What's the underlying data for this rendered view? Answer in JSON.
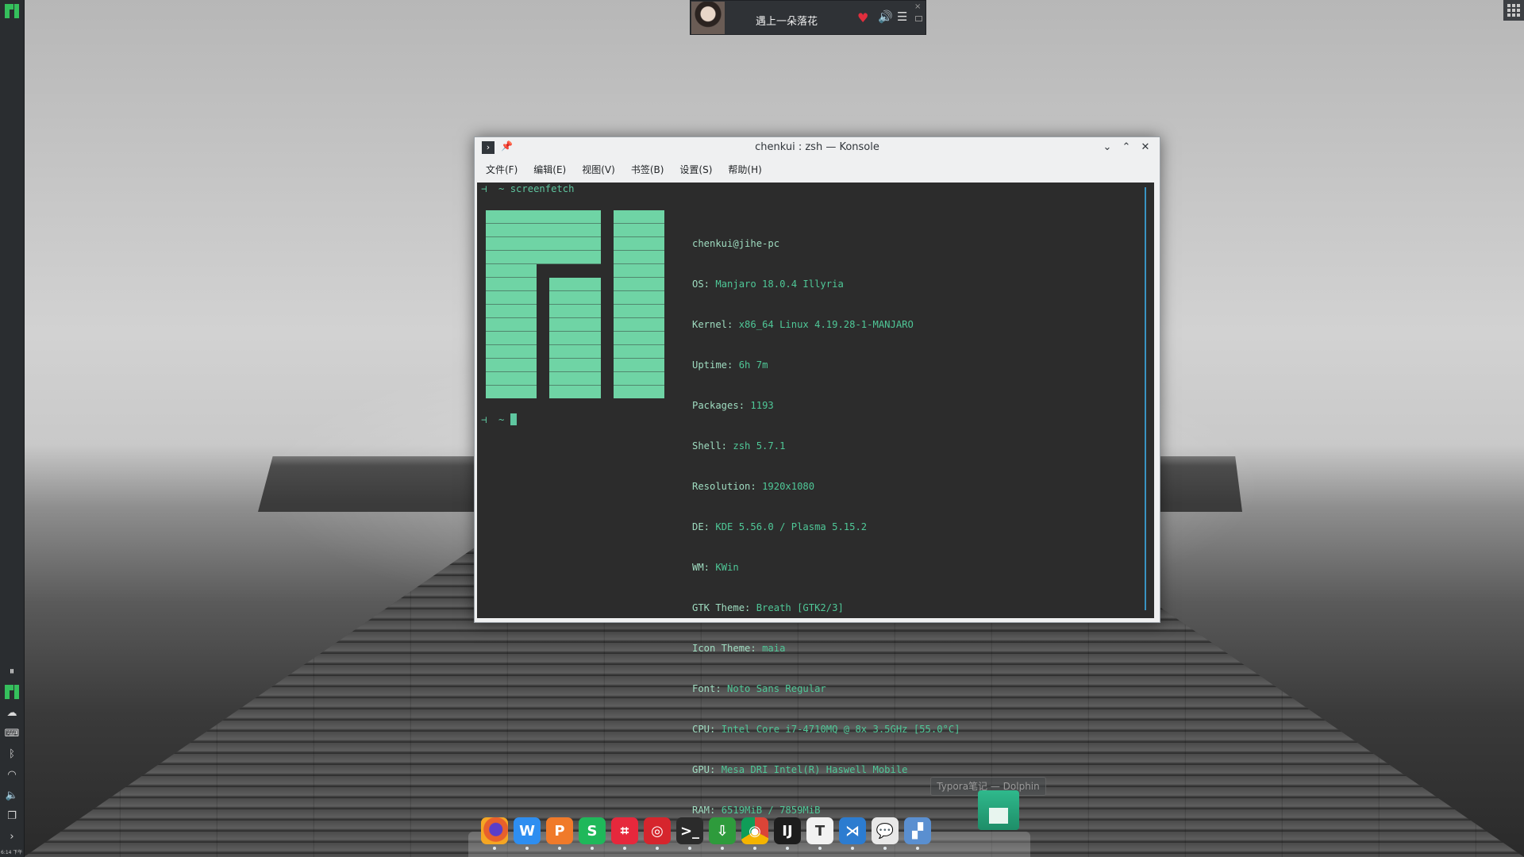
{
  "music": {
    "song_title": "遇上一朵落花",
    "heart_glyph": "♥",
    "volume_glyph": "🔊",
    "playlist_glyph": "☰",
    "close_glyph": "×"
  },
  "window": {
    "title": "chenkui : zsh — Konsole",
    "menus": [
      "文件(F)",
      "编辑(E)",
      "视图(V)",
      "书签(B)",
      "设置(S)",
      "帮助(H)"
    ]
  },
  "terminal": {
    "prompt_symbol": "⊣",
    "command": "screenfetch",
    "user_host": "chenkui@jihe-pc",
    "info": [
      {
        "key": "OS:",
        "value": "Manjaro 18.0.4 Illyria"
      },
      {
        "key": "Kernel:",
        "value": "x86_64 Linux 4.19.28-1-MANJARO"
      },
      {
        "key": "Uptime:",
        "value": "6h 7m"
      },
      {
        "key": "Packages:",
        "value": "1193"
      },
      {
        "key": "Shell:",
        "value": "zsh 5.7.1"
      },
      {
        "key": "Resolution:",
        "value": "1920x1080"
      },
      {
        "key": "DE:",
        "value": "KDE 5.56.0 / Plasma 5.15.2"
      },
      {
        "key": "WM:",
        "value": "KWin"
      },
      {
        "key": "GTK Theme:",
        "value": "Breath [GTK2/3]"
      },
      {
        "key": "Icon Theme:",
        "value": "maia"
      },
      {
        "key": "Font:",
        "value": "Noto Sans Regular"
      },
      {
        "key": "CPU:",
        "value": "Intel Core i7-4710MQ @ 8x 3.5GHz [55.0°C]"
      },
      {
        "key": "GPU:",
        "value": "Mesa DRI Intel(R) Haswell Mobile"
      },
      {
        "key": "RAM:",
        "value": "6519MiB / 7859MiB"
      }
    ]
  },
  "tooltip": "Typora笔记 — Dolphin",
  "clock": "6:14 下午",
  "dock": [
    {
      "name": "firefox",
      "color": "#e8602c",
      "glyph": ""
    },
    {
      "name": "wps-writer",
      "color": "#2e8ef0",
      "glyph": "W"
    },
    {
      "name": "wps-presentation",
      "color": "#f07a2a",
      "glyph": "P"
    },
    {
      "name": "wps-spreadsheet",
      "color": "#1fb85a",
      "glyph": "S"
    },
    {
      "name": "screenshot-crop",
      "color": "#e6283c",
      "glyph": "⌗"
    },
    {
      "name": "netease-music",
      "color": "#d6252d",
      "glyph": "◎"
    },
    {
      "name": "terminal",
      "color": "#2b2b2b",
      "glyph": ">_"
    },
    {
      "name": "download-manager",
      "color": "#2e9b3c",
      "glyph": "⇩"
    },
    {
      "name": "chrome",
      "color": "#dcbc2a",
      "glyph": "◉"
    },
    {
      "name": "intellij",
      "color": "#1d1d1d",
      "glyph": "IJ"
    },
    {
      "name": "typora",
      "color": "#f2f2f2",
      "glyph": "T"
    },
    {
      "name": "vscode",
      "color": "#2c7cd0",
      "glyph": "⋊"
    },
    {
      "name": "wechat",
      "color": "#e8e8e8",
      "glyph": "💬"
    },
    {
      "name": "image-editor",
      "color": "#5a8fd0",
      "glyph": "▞"
    }
  ]
}
